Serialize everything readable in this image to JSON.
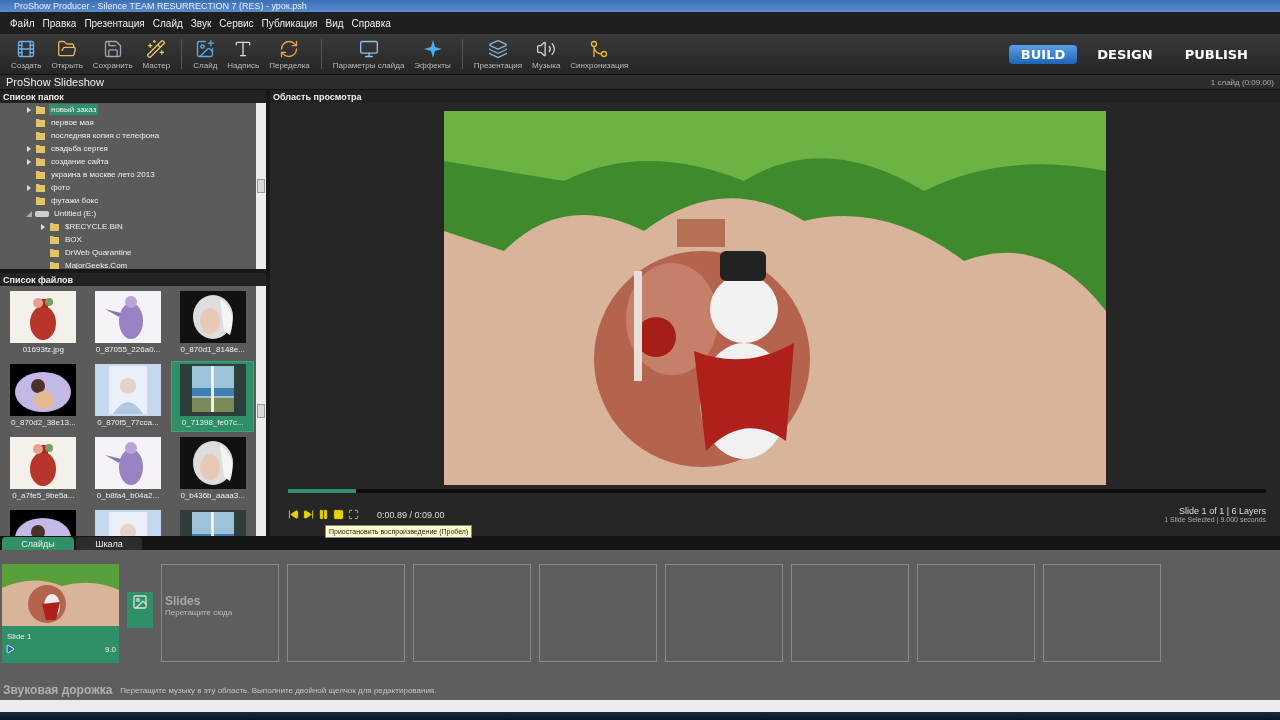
{
  "window": {
    "title": "ProShow Producer - Silence TEAM RESURRECTION 7 (RES) - урок.psh"
  },
  "menu": [
    "Файл",
    "Правка",
    "Презентация",
    "Слайд",
    "Звук",
    "Сервис",
    "Публикация",
    "Вид",
    "Справка"
  ],
  "toolbar": [
    {
      "label": "Создать",
      "kind": "film"
    },
    {
      "label": "Открыть",
      "kind": "folder"
    },
    {
      "label": "Сохранить",
      "kind": "save"
    },
    {
      "label": "Мастер",
      "kind": "wand"
    },
    {
      "label": "Слайд",
      "kind": "slide",
      "group_start": true
    },
    {
      "label": "Надпись",
      "kind": "text"
    },
    {
      "label": "Переделка",
      "kind": "remix"
    },
    {
      "label": "Параметры слайда",
      "kind": "monitor",
      "group_start": true
    },
    {
      "label": "Эффекты",
      "kind": "fx"
    },
    {
      "label": "Презентация",
      "kind": "layers",
      "group_start": true
    },
    {
      "label": "Музыка",
      "kind": "sound"
    },
    {
      "label": "Синхронизация",
      "kind": "sync"
    }
  ],
  "modes": [
    {
      "label": "BUILD",
      "selected": true
    },
    {
      "label": "DESIGN",
      "selected": false
    },
    {
      "label": "PUBLISH",
      "selected": false
    }
  ],
  "show_bar": {
    "title": "ProShow Slideshow",
    "info": "1 слайд (0:09.00)"
  },
  "folders": {
    "title": "Список папок",
    "items": [
      {
        "label": "новый заказ",
        "kind": "folder",
        "expandable": true,
        "selected": true
      },
      {
        "label": "первое мая",
        "kind": "folder",
        "expandable": false,
        "selected": false
      },
      {
        "label": "последняя копия с телефона",
        "kind": "folder",
        "expandable": false,
        "selected": false
      },
      {
        "label": "свадьба сергея",
        "kind": "folder",
        "expandable": true,
        "selected": false
      },
      {
        "label": "создание сайта",
        "kind": "folder",
        "expandable": true,
        "selected": false
      },
      {
        "label": "украина в москве лето 2013",
        "kind": "folder",
        "expandable": false,
        "selected": false
      },
      {
        "label": "фото",
        "kind": "folder",
        "expandable": true,
        "selected": false
      },
      {
        "label": "футажи бокс",
        "kind": "folder",
        "expandable": false,
        "selected": false
      },
      {
        "label": "Untitled (E:)",
        "kind": "drive",
        "expandable": true,
        "selected": false,
        "children": [
          {
            "label": "$RECYCLE.BIN",
            "kind": "folder",
            "expandable": true,
            "selected": false
          },
          {
            "label": "BOX",
            "kind": "folder",
            "expandable": false,
            "selected": false
          },
          {
            "label": "DrWeb Quarantine",
            "kind": "folder",
            "expandable": false,
            "selected": false
          },
          {
            "label": "MajorGeeks.Com",
            "kind": "folder",
            "expandable": false,
            "selected": false
          }
        ]
      }
    ]
  },
  "files": {
    "title": "Список файлов",
    "items": [
      {
        "name": "01693fz.jpg",
        "selected": false
      },
      {
        "name": "0_87055_226a0...",
        "selected": false
      },
      {
        "name": "0_870d1_8148e...",
        "selected": false
      },
      {
        "name": "0_870d2_38e13...",
        "selected": false
      },
      {
        "name": "0_870f5_77cca...",
        "selected": false
      },
      {
        "name": "0_71398_fe07c...",
        "selected": true
      },
      {
        "name": "0_a7fe5_9be5a...",
        "selected": false
      },
      {
        "name": "0_b8fa4_b04a2...",
        "selected": false
      },
      {
        "name": "0_b436b_aaaa3...",
        "selected": false
      },
      {
        "selected": false
      },
      {
        "selected": false
      },
      {
        "selected": false
      }
    ]
  },
  "preview": {
    "title": "Область просмотра",
    "level": 0.07,
    "time": "0:00.89 / 0:09.00",
    "status_1": "Slide 1 of 1  |  6 Layers",
    "status_2": "1 Slide Selected  |  9.000 seconds",
    "tooltip": "Приостановить воспроизведение (Пробел)"
  },
  "bottom_tabs": [
    {
      "label": "Слайды",
      "selected": true
    },
    {
      "label": "Шкала",
      "selected": false
    }
  ],
  "slides": [
    {
      "name": "Slide 1",
      "duration": "9.0"
    }
  ],
  "slide_hint": {
    "title": "Slides",
    "text": "Перетащите сюда"
  },
  "soundtrack": {
    "title": "Звуковая дорожка",
    "hint": "Перетащите музыку в эту область. Выполните двойной щелчок для редактирования."
  }
}
